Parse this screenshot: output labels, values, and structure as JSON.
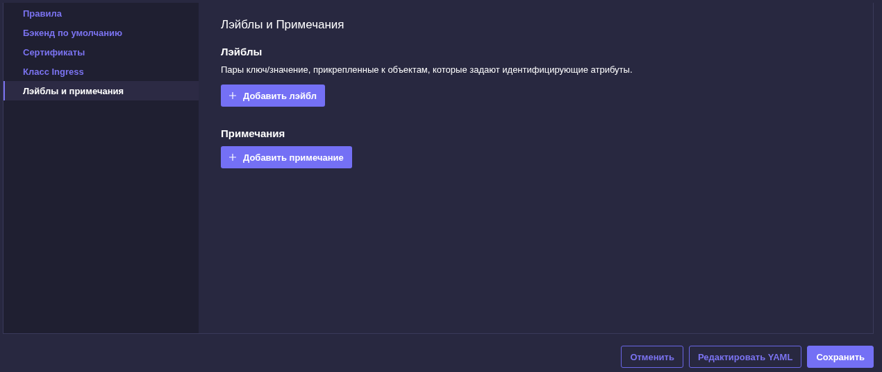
{
  "sidebar": {
    "items": [
      {
        "label": "Правила",
        "selected": false
      },
      {
        "label": "Бэкенд по умолчанию",
        "selected": false
      },
      {
        "label": "Сертификаты",
        "selected": false
      },
      {
        "label": "Класс Ingress",
        "selected": false
      },
      {
        "label": "Лэйблы и примечания",
        "selected": true
      }
    ]
  },
  "content": {
    "title": "Лэйблы и Примечания",
    "sections": [
      {
        "heading": "Лэйблы",
        "description": "Пары ключ/значение, прикрепленные к объектам, которые задают идентифицирующие атрибуты.",
        "button": "Добавить лэйбл"
      },
      {
        "heading": "Примечания",
        "button": "Добавить примечание"
      }
    ]
  },
  "footer": {
    "buttons": [
      {
        "label": "Отменить",
        "kind": "outline"
      },
      {
        "label": "Редактировать YAML",
        "kind": "outline"
      },
      {
        "label": "Сохранить",
        "kind": "primary"
      }
    ]
  }
}
